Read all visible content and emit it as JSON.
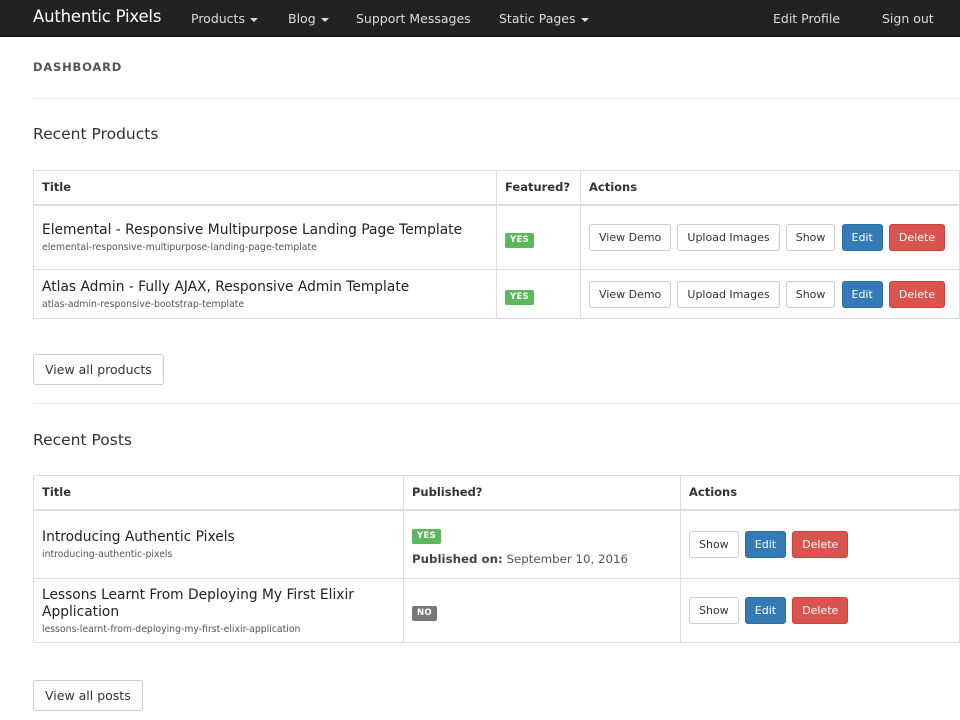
{
  "navbar": {
    "brand": "Authentic Pixels",
    "items": [
      {
        "label": "Products",
        "dropdown": true
      },
      {
        "label": "Blog",
        "dropdown": true
      },
      {
        "label": "Support Messages",
        "dropdown": false
      },
      {
        "label": "Static Pages",
        "dropdown": true
      }
    ],
    "right_items": [
      {
        "label": "Edit Profile"
      },
      {
        "label": "Sign out"
      }
    ]
  },
  "page": {
    "title": "DASHBOARD"
  },
  "products": {
    "heading": "Recent Products",
    "columns": [
      "Title",
      "Featured?",
      "Actions"
    ],
    "rows": [
      {
        "title": "Elemental - Responsive Multipurpose Landing Page Template",
        "slug": "elemental-responsive-multipurpose-landing-page-template",
        "featured": "YES"
      },
      {
        "title": "Atlas Admin - Fully AJAX, Responsive Admin Template",
        "slug": "atlas-admin-responsive-bootstrap-template",
        "featured": "YES"
      }
    ],
    "actions": {
      "view_demo": "View Demo",
      "upload_images": "Upload Images",
      "show": "Show",
      "edit": "Edit",
      "delete": "Delete"
    },
    "view_all": "View all products"
  },
  "posts": {
    "heading": "Recent Posts",
    "columns": [
      "Title",
      "Published?",
      "Actions"
    ],
    "rows": [
      {
        "title": "Introducing Authentic Pixels",
        "slug": "introducing-authentic-pixels",
        "published": "YES",
        "published_on_label": "Published on:",
        "published_on_date": "September 10, 2016"
      },
      {
        "title": "Lessons Learnt From Deploying My First Elixir Application",
        "slug": "lessons-learnt-from-deploying-my-first-elixir-application",
        "published": "NO"
      }
    ],
    "actions": {
      "show": "Show",
      "edit": "Edit",
      "delete": "Delete"
    },
    "view_all": "View all posts"
  },
  "colors": {
    "navbar_bg": "#222222",
    "success": "#5cb85c",
    "primary": "#337ab7",
    "danger": "#d9534f",
    "muted": "#777777"
  }
}
